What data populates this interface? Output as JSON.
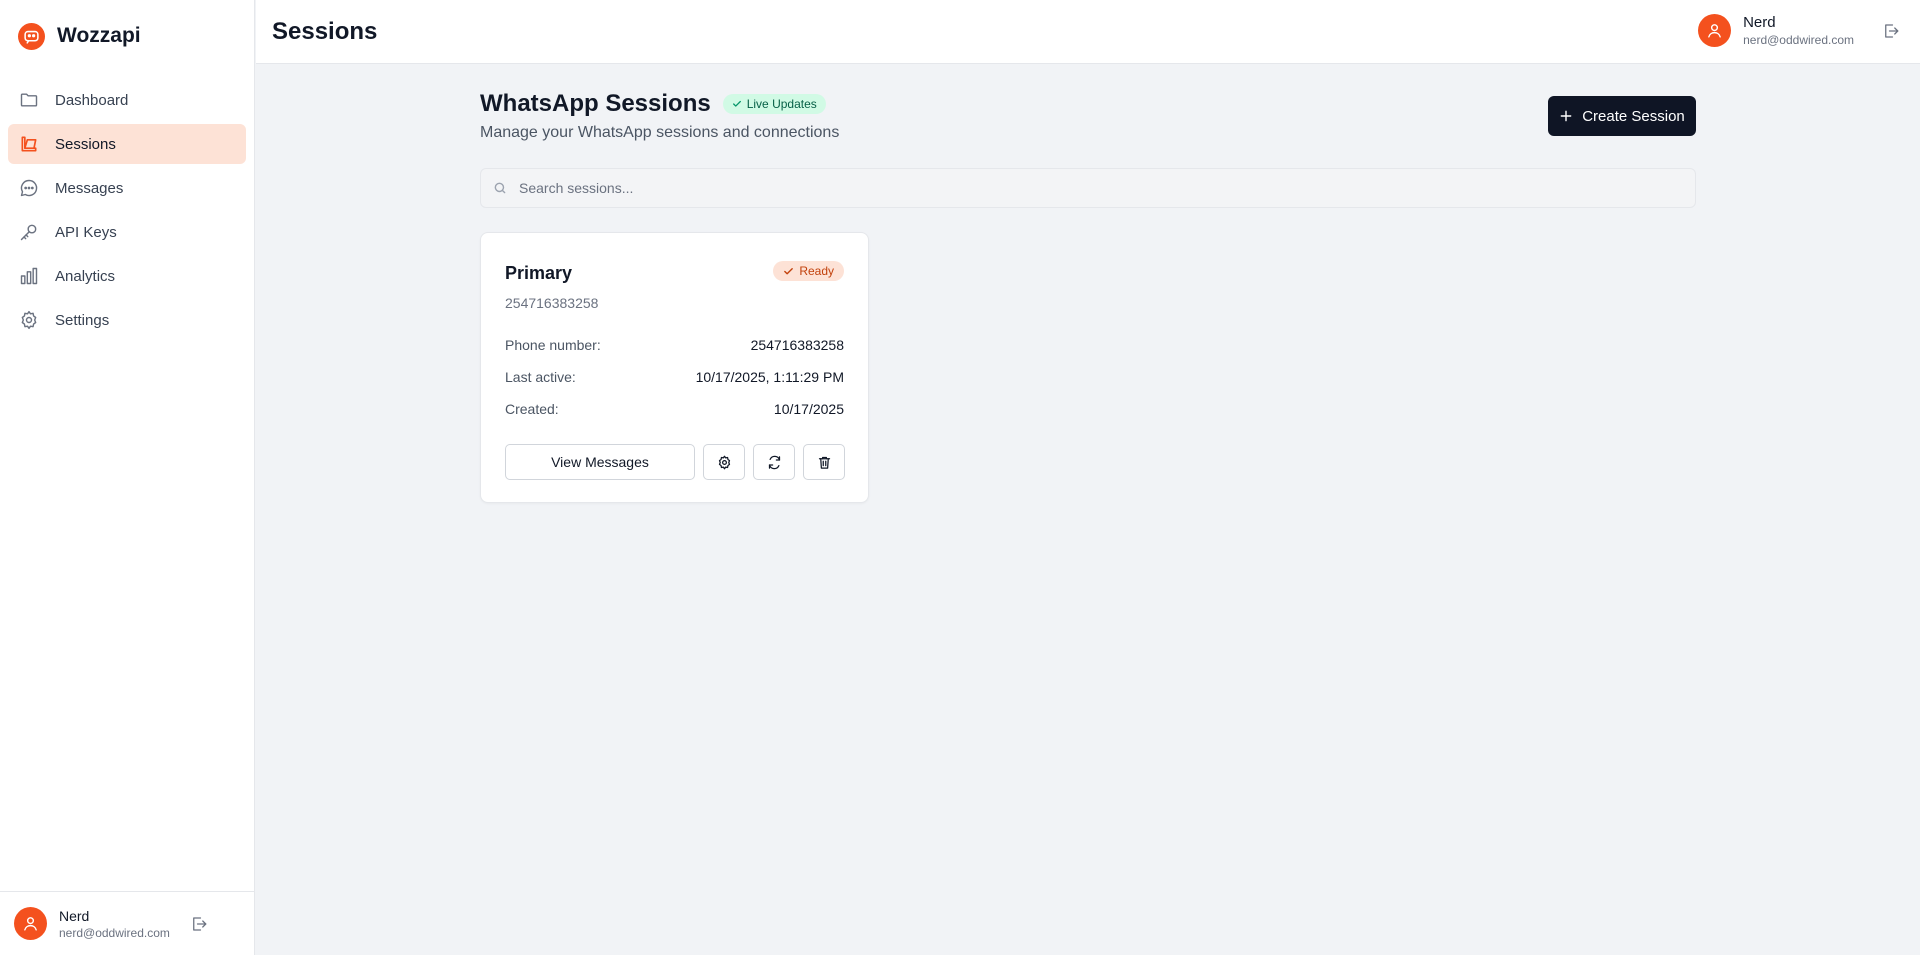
{
  "app": {
    "name": "Wozzapi"
  },
  "sidebar": {
    "items": [
      {
        "label": "Dashboard",
        "icon": "folder-icon",
        "active": false
      },
      {
        "label": "Sessions",
        "icon": "sessions-icon",
        "active": true
      },
      {
        "label": "Messages",
        "icon": "message-icon",
        "active": false
      },
      {
        "label": "API Keys",
        "icon": "key-icon",
        "active": false
      },
      {
        "label": "Analytics",
        "icon": "bar-chart-icon",
        "active": false
      },
      {
        "label": "Settings",
        "icon": "gear-icon",
        "active": false
      }
    ],
    "user": {
      "name": "Nerd",
      "email": "nerd@oddwired.com"
    }
  },
  "header": {
    "title": "Sessions",
    "user": {
      "name": "Nerd",
      "email": "nerd@oddwired.com"
    }
  },
  "main": {
    "title": "WhatsApp Sessions",
    "live_badge": "Live Updates",
    "subtitle": "Manage your WhatsApp sessions and connections",
    "create_button": "Create Session",
    "search": {
      "placeholder": "Search sessions...",
      "value": ""
    }
  },
  "sessions": [
    {
      "name": "Primary",
      "phone": "254716383258",
      "status": "Ready",
      "phone_label": "Phone number:",
      "phone_value": "254716383258",
      "last_active_label": "Last active:",
      "last_active_value": "10/17/2025, 1:11:29 PM",
      "created_label": "Created:",
      "created_value": "10/17/2025",
      "view_button": "View Messages"
    }
  ],
  "colors": {
    "accent": "#f4511e",
    "active_bg": "#fde2d6",
    "primary_button": "#0f1525",
    "live_badge_bg": "#d1fae5"
  }
}
